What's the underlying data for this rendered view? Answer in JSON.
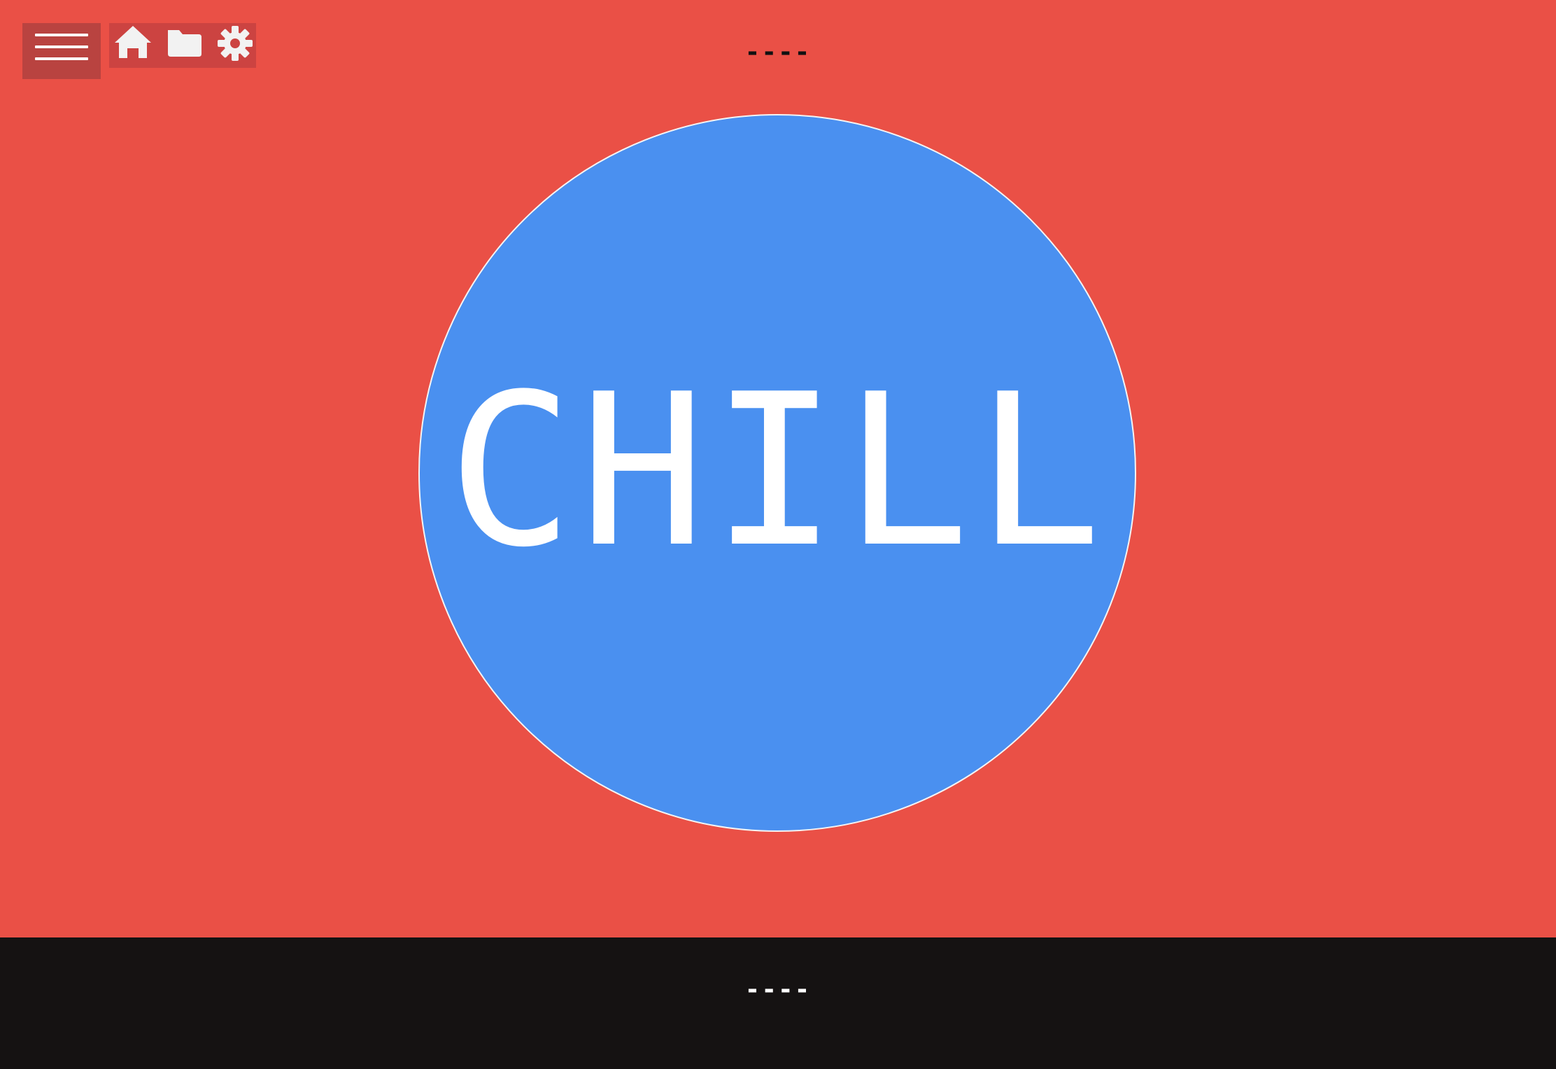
{
  "header": {
    "menu_icon": "hamburger-menu-icon",
    "toolbar_icons": [
      "home-icon",
      "folder-icon",
      "gear-icon"
    ],
    "status_text": "----"
  },
  "main": {
    "circle_label": "CHILL"
  },
  "footer": {
    "status_text": "----"
  },
  "colors": {
    "background": "#ea5046",
    "menu_button": "#b94340",
    "toolbar": "#cc4341",
    "circle": "#4a90f0",
    "circle_border": "#f4f4f4",
    "bottom_bar": "#151212",
    "icon": "#f2f2f2"
  }
}
